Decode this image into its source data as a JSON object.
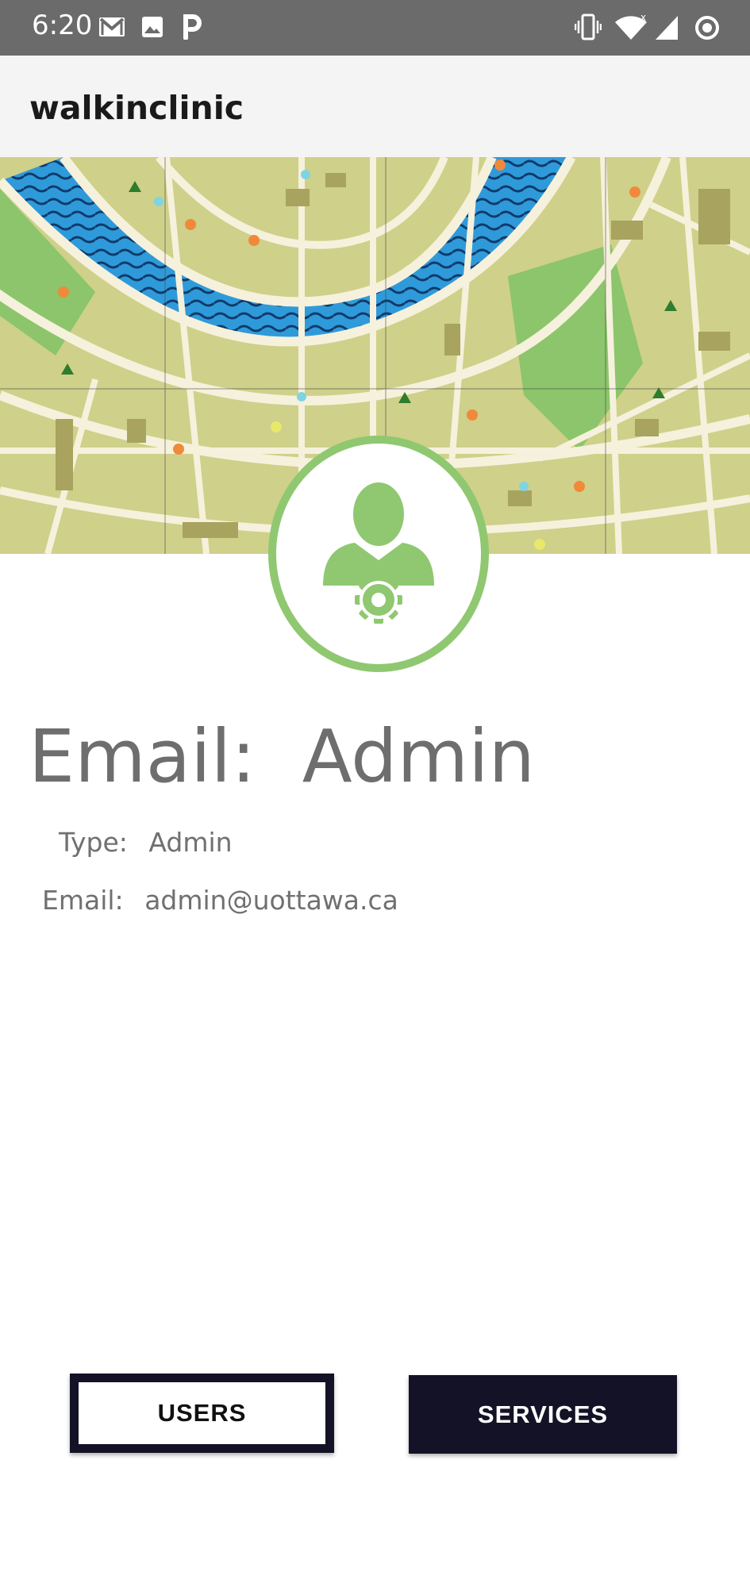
{
  "status_bar": {
    "time": "6:20",
    "left_icons": [
      "gmail-icon",
      "photo-icon",
      "parking-app-icon"
    ],
    "right_icons": [
      "vibrate-icon",
      "wifi-icon",
      "signal-icon",
      "sync-icon"
    ]
  },
  "app_bar": {
    "title": "walkinclinic"
  },
  "banner": {
    "image": "city-map-illustration"
  },
  "avatar": {
    "icon": "admin-user-gear-icon",
    "accent_color": "#8fc870"
  },
  "profile": {
    "heading_label": "Email:",
    "heading_value": "Admin",
    "type_label": "Type:",
    "type_value": "Admin",
    "email_label": "Email:",
    "email_value": "admin@uottawa.ca"
  },
  "actions": {
    "users_label": "USERS",
    "services_label": "SERVICES"
  },
  "colors": {
    "status_bar": "#6b6b6b",
    "app_bar": "#f4f4f4",
    "button_dark": "#141226",
    "text_gray": "#6e6e6e"
  }
}
